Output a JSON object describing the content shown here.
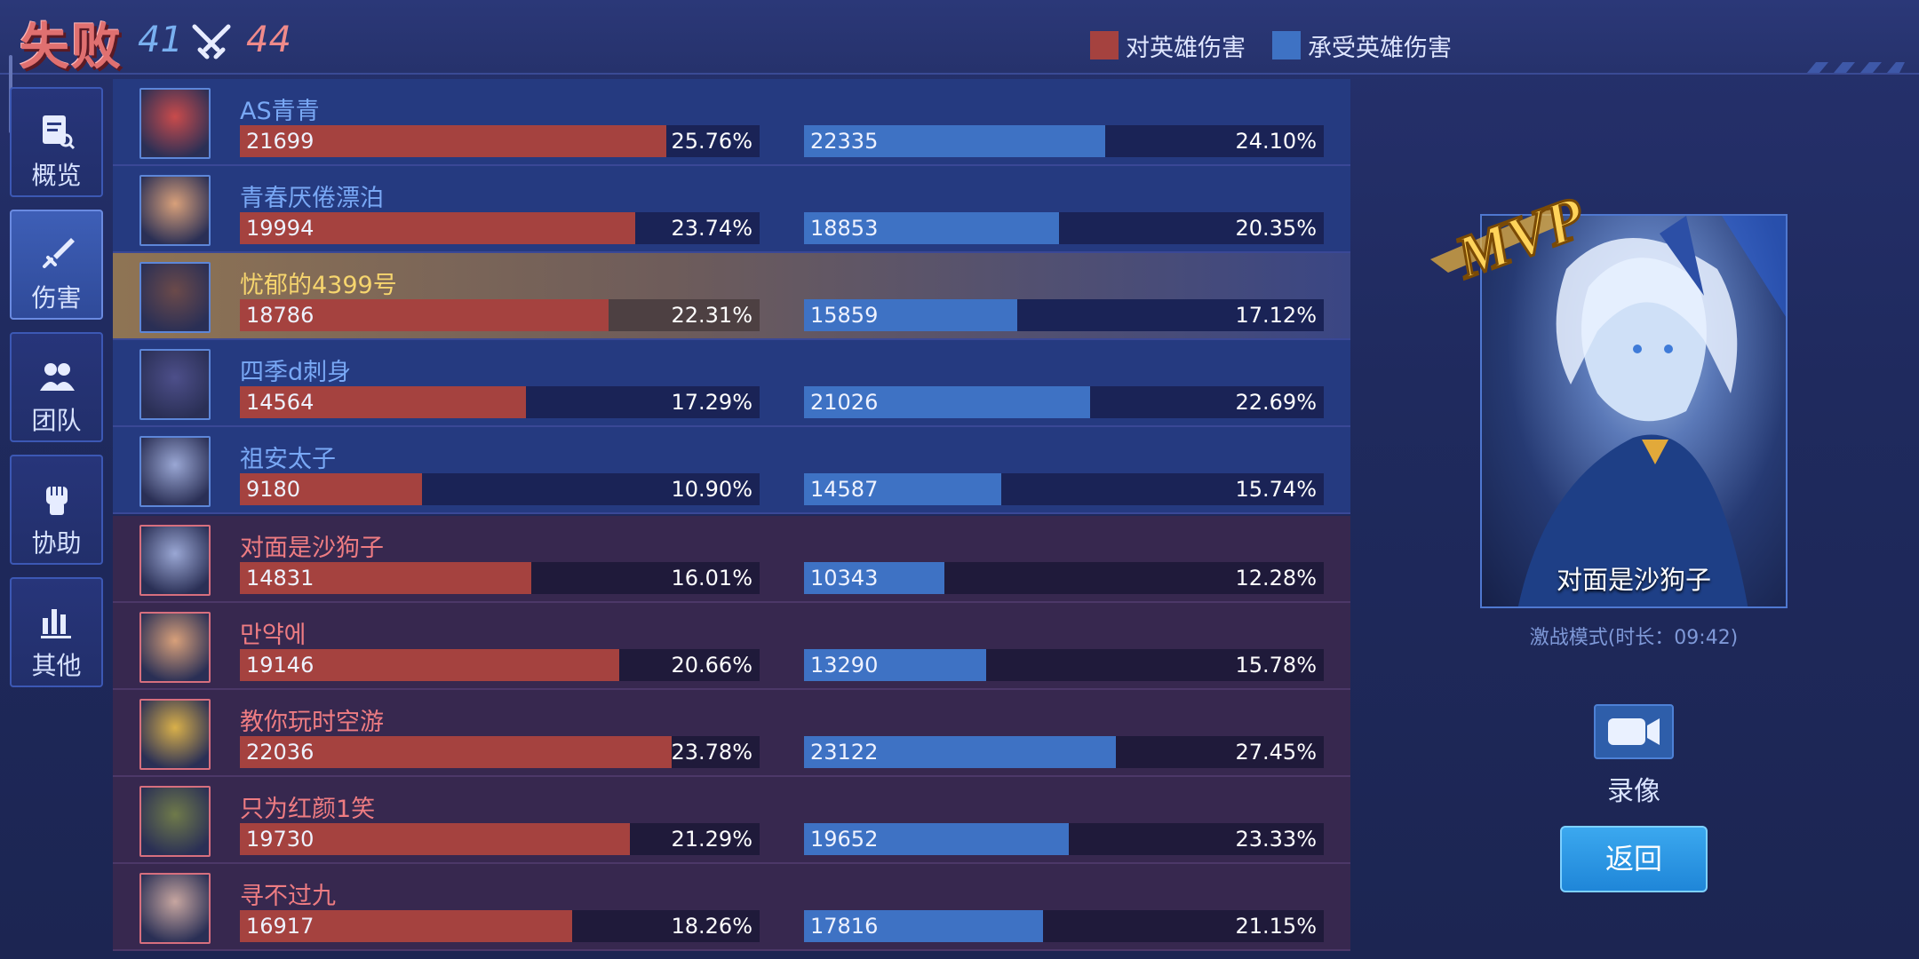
{
  "header": {
    "result": "失败",
    "score_blue": "41",
    "score_red": "44",
    "legend_dealt": "对英雄伤害",
    "legend_taken": "承受英雄伤害",
    "color_dealt": "#a5423f",
    "color_taken": "#3e72c4"
  },
  "sidebar": {
    "items": [
      {
        "label": "概览",
        "icon": "document-search-icon"
      },
      {
        "label": "伤害",
        "icon": "sword-icon",
        "active": true
      },
      {
        "label": "团队",
        "icon": "team-icon"
      },
      {
        "label": "协助",
        "icon": "fist-icon"
      },
      {
        "label": "其他",
        "icon": "bar-chart-icon"
      }
    ]
  },
  "players": [
    {
      "name": "AS青青",
      "team": "blue",
      "dealt": "21699",
      "dealt_pct": "25.76%",
      "dealt_frac": 0.82,
      "taken": "22335",
      "taken_pct": "24.10%",
      "taken_frac": 0.58
    },
    {
      "name": "青春厌倦漂泊",
      "team": "blue",
      "dealt": "19994",
      "dealt_pct": "23.74%",
      "dealt_frac": 0.76,
      "taken": "18853",
      "taken_pct": "20.35%",
      "taken_frac": 0.49
    },
    {
      "name": "忧郁的4399号",
      "team": "blue",
      "highlight": true,
      "dealt": "18786",
      "dealt_pct": "22.31%",
      "dealt_frac": 0.71,
      "taken": "15859",
      "taken_pct": "17.12%",
      "taken_frac": 0.41
    },
    {
      "name": "四季d刺身",
      "team": "blue",
      "dealt": "14564",
      "dealt_pct": "17.29%",
      "dealt_frac": 0.55,
      "taken": "21026",
      "taken_pct": "22.69%",
      "taken_frac": 0.55
    },
    {
      "name": "祖安太子",
      "team": "blue",
      "dealt": "9180",
      "dealt_pct": "10.90%",
      "dealt_frac": 0.35,
      "taken": "14587",
      "taken_pct": "15.74%",
      "taken_frac": 0.38
    },
    {
      "name": "对面是沙狗子",
      "team": "red",
      "dealt": "14831",
      "dealt_pct": "16.01%",
      "dealt_frac": 0.56,
      "taken": "10343",
      "taken_pct": "12.28%",
      "taken_frac": 0.27
    },
    {
      "name": "만약에",
      "team": "red",
      "dealt": "19146",
      "dealt_pct": "20.66%",
      "dealt_frac": 0.73,
      "taken": "13290",
      "taken_pct": "15.78%",
      "taken_frac": 0.35
    },
    {
      "name": "教你玩时空游",
      "team": "red",
      "dealt": "22036",
      "dealt_pct": "23.78%",
      "dealt_frac": 0.83,
      "taken": "23122",
      "taken_pct": "27.45%",
      "taken_frac": 0.6
    },
    {
      "name": "只为红颜1笑",
      "team": "red",
      "dealt": "19730",
      "dealt_pct": "21.29%",
      "dealt_frac": 0.75,
      "taken": "19652",
      "taken_pct": "23.33%",
      "taken_frac": 0.51
    },
    {
      "name": "寻不过九",
      "team": "red",
      "dealt": "16917",
      "dealt_pct": "18.26%",
      "dealt_frac": 0.64,
      "taken": "17816",
      "taken_pct": "21.15%",
      "taken_frac": 0.46
    }
  ],
  "mvp": {
    "badge": "MVP",
    "player_name": "对面是沙狗子",
    "mode": "激战模式(时长：09:42)"
  },
  "actions": {
    "record_label": "录像",
    "back_label": "返回"
  }
}
